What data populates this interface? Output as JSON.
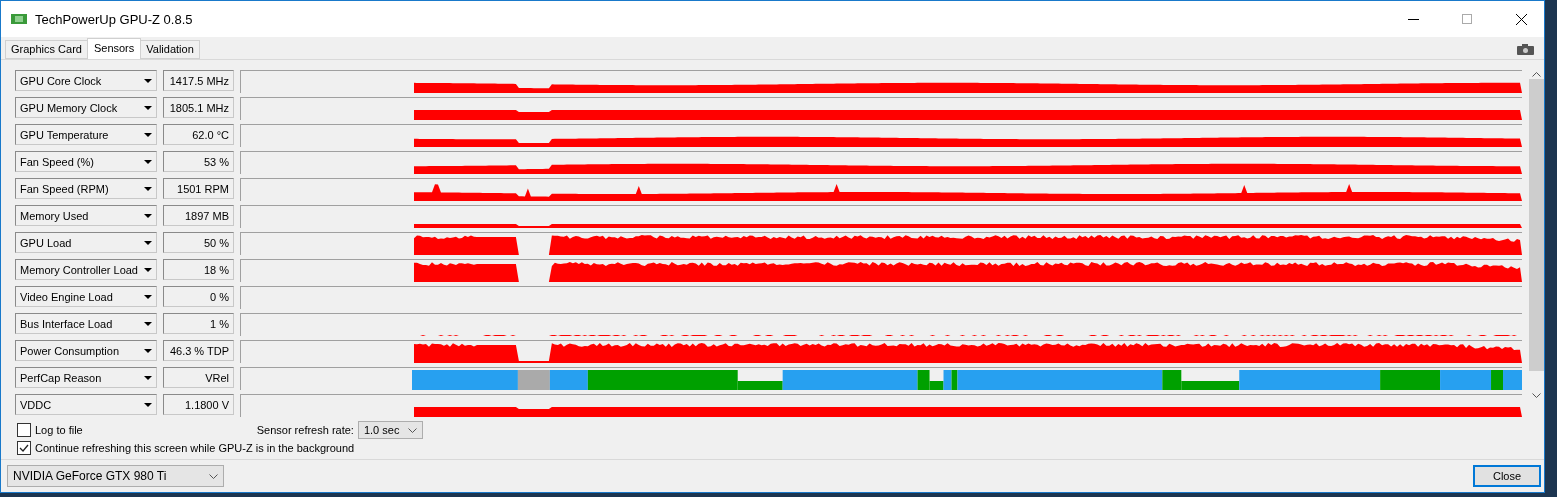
{
  "window": {
    "title": "TechPowerUp GPU-Z 0.8.5"
  },
  "tabs": [
    {
      "label": "Graphics Card",
      "selected": false
    },
    {
      "label": "Sensors",
      "selected": true
    },
    {
      "label": "Validation",
      "selected": false
    }
  ],
  "sensors": [
    {
      "name": "GPU Core Clock",
      "value": "1417.5 MHz",
      "kind": "steady"
    },
    {
      "name": "GPU Memory Clock",
      "value": "1805.1 MHz",
      "kind": "flat"
    },
    {
      "name": "GPU Temperature",
      "value": "62.0 °C",
      "kind": "steady"
    },
    {
      "name": "Fan Speed (%)",
      "value": "53 %",
      "kind": "steady"
    },
    {
      "name": "Fan Speed (RPM)",
      "value": "1501 RPM",
      "kind": "spiky"
    },
    {
      "name": "Memory Used",
      "value": "1897 MB",
      "kind": "low"
    },
    {
      "name": "GPU Load",
      "value": "50 %",
      "kind": "noisy"
    },
    {
      "name": "Memory Controller Load",
      "value": "18 %",
      "kind": "noisy"
    },
    {
      "name": "Video Engine Load",
      "value": "0 %",
      "kind": "empty"
    },
    {
      "name": "Bus Interface Load",
      "value": "1 %",
      "kind": "sparse"
    },
    {
      "name": "Power Consumption",
      "value": "46.3 % TDP",
      "kind": "noisy"
    },
    {
      "name": "PerfCap Reason",
      "value": "VRel",
      "kind": "perfcap"
    },
    {
      "name": "VDDC",
      "value": "1.1800 V",
      "kind": "flat"
    }
  ],
  "log_to_file": {
    "label": "Log to file",
    "checked": false
  },
  "refresh_rate": {
    "label": "Sensor refresh rate:",
    "value": "1.0 sec"
  },
  "continue_refreshing": {
    "label": "Continue refreshing this screen while GPU-Z is in the background",
    "checked": true
  },
  "gpu_select": {
    "value": "NVIDIA GeForce GTX 980 Ti"
  },
  "close_button": "Close"
}
